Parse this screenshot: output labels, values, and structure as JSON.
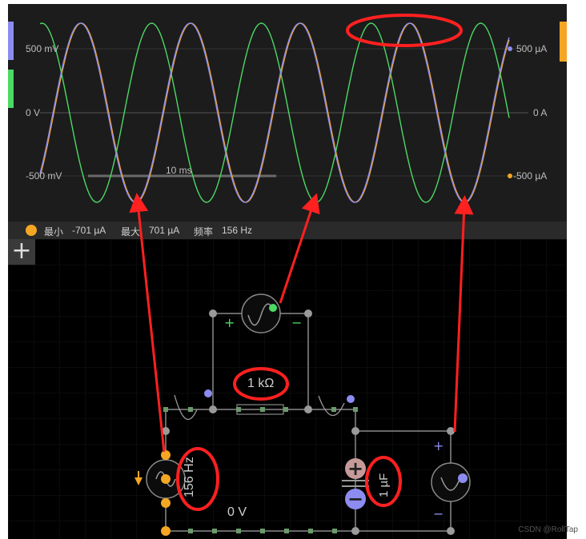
{
  "scope": {
    "left_axis": {
      "top": "500 mV",
      "mid": "0 V",
      "bottom": "-500 mV"
    },
    "right_axis": {
      "top": "500 µA",
      "mid": "0 A",
      "bottom": "-500 µA"
    },
    "time_scale": "10 ms",
    "colors": {
      "orange": "#f5a623",
      "green": "#4cd964",
      "purple": "#8c8cf0"
    }
  },
  "status": {
    "min_label": "最小",
    "min_value": "-701 µA",
    "max_label": "最大",
    "max_value": "701 µA",
    "freq_label": "频率",
    "freq_value": "156 Hz"
  },
  "toolbar": {
    "add_label": "+"
  },
  "circuit": {
    "resistor_value": "1 kΩ",
    "source_freq": "156 Hz",
    "capacitor_value": "1 µF",
    "ground_label": "0 V",
    "plus": "+",
    "minus": "−"
  },
  "watermark": "CSDN @RollTap"
}
